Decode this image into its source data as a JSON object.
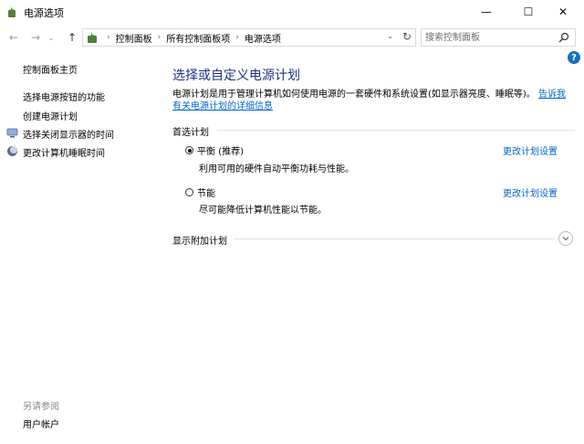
{
  "window": {
    "title": "电源选项",
    "minimize_glyph": "—",
    "maximize_glyph": "☐",
    "close_glyph": "✕"
  },
  "address_bar": {
    "crumbs": [
      "控制面板",
      "所有控制面板项",
      "电源选项"
    ],
    "separator": "›",
    "dropdown_glyph": "⌄",
    "refresh_glyph": "↻"
  },
  "nav": {
    "back_glyph": "←",
    "forward_glyph": "→",
    "recent_glyph": "⌄",
    "up_glyph": "↑"
  },
  "search": {
    "placeholder": "搜索控制面板"
  },
  "help_glyph": "?",
  "sidebar": {
    "home": "控制面板主页",
    "links": [
      {
        "label": "选择电源按钮的功能",
        "icon": ""
      },
      {
        "label": "创建电源计划",
        "icon": ""
      },
      {
        "label": "选择关闭显示器的时间",
        "icon": "monitor-icon"
      },
      {
        "label": "更改计算机睡眠时间",
        "icon": "sleep-moon-icon"
      }
    ],
    "see_also": "另请参阅",
    "user_accounts": "用户帐户"
  },
  "main": {
    "heading": "选择或自定义电源计划",
    "description": "电源计划是用于管理计算机如何使用电源的一套硬件和系统设置(如显示器亮度、睡眠等)。",
    "description_link": "告诉我有关电源计划的详细信息",
    "preferred_label": "首选计划",
    "plans": [
      {
        "name": "平衡 (推荐)",
        "desc": "利用可用的硬件自动平衡功耗与性能。",
        "change": "更改计划设置",
        "selected": true
      },
      {
        "name": "节能",
        "desc": "尽可能降低计算机性能以节能。",
        "change": "更改计划设置",
        "selected": false
      }
    ],
    "show_more_label": "显示附加计划"
  },
  "colors": {
    "heading": "#1e3287",
    "link": "#0066cc",
    "muted": "#888888"
  }
}
